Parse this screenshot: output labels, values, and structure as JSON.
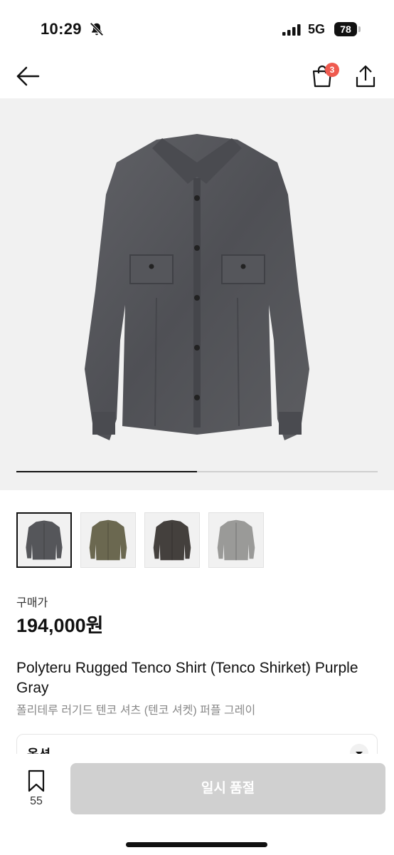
{
  "status_bar": {
    "time": "10:29",
    "network": "5G",
    "battery": "78"
  },
  "nav": {
    "cart_count": "3",
    "icons": [
      "back-arrow-icon",
      "shopping-bag-icon",
      "share-icon"
    ]
  },
  "gallery": {
    "progress": 0.5,
    "thumbnail_colors": [
      "#55565a",
      "#6b6850",
      "#44403d",
      "#9a9a98"
    ],
    "selected_index": 0
  },
  "product": {
    "price_label": "구매가",
    "price": "194,000원",
    "title_en": "Polyteru Rugged Tenco Shirt (Tenco Shirket) Purple Gray",
    "title_ko": "폴리테루 러기드 텐코 셔츠 (텐코 셔켓) 퍼플 그레이"
  },
  "options": {
    "label": "옵션"
  },
  "bottom_bar": {
    "bookmark_count": "55",
    "sold_out_label": "일시 품절"
  },
  "colors": {
    "badge": "#ef5a4f",
    "disabled_button": "#d0d0d0"
  }
}
